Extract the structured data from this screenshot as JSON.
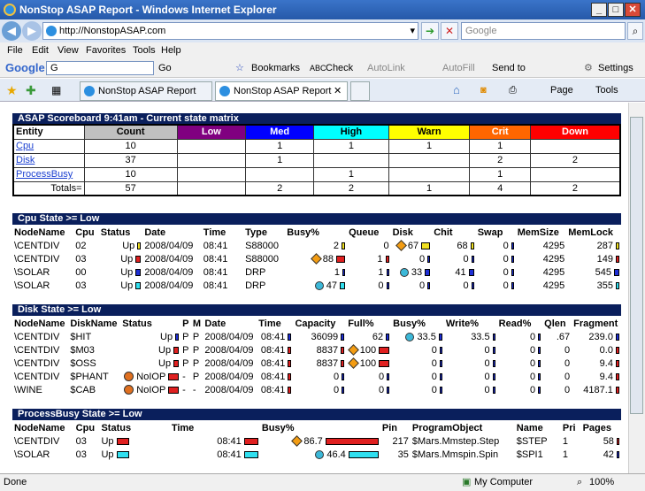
{
  "window": {
    "title": "NonStop ASAP Report - Windows Internet Explorer"
  },
  "address": {
    "url": "http://NonstopASAP.com",
    "search_placeholder": "Google"
  },
  "menu": [
    "File",
    "Edit",
    "View",
    "Favorites",
    "Tools",
    "Help"
  ],
  "google_bar": {
    "logo": "Google",
    "go": "Go",
    "bookmarks": "Bookmarks",
    "check": "Check",
    "autolink": "AutoLink",
    "autofill": "AutoFill",
    "sendto": "Send to",
    "settings": "Settings"
  },
  "tabs": [
    "NonStop ASAP Report",
    "NonStop ASAP Report"
  ],
  "cmdbar": {
    "page": "Page",
    "tools": "Tools"
  },
  "status": {
    "left": "Done",
    "zone": "My Computer",
    "zoom": "100%"
  },
  "scoreboard": {
    "title": "ASAP Scoreboard 9:41am - Current state matrix",
    "headers": [
      "Entity",
      "Count",
      "Low",
      "Med",
      "High",
      "Warn",
      "Crit",
      "Down"
    ],
    "header_colors": [
      "#ffffff",
      "#c0c0c0",
      "#800080",
      "#0000ff",
      "#00ffff",
      "#ffff00",
      "#ff6600",
      "#ff0000"
    ],
    "rows": [
      [
        "Cpu",
        "10",
        "",
        "1",
        "1",
        "1",
        "1",
        ""
      ],
      [
        "Disk",
        "37",
        "",
        "1",
        "",
        "",
        "2",
        "2"
      ],
      [
        "ProcessBusy",
        "10",
        "",
        "",
        "1",
        "",
        "1",
        ""
      ],
      [
        "Totals=",
        "57",
        "",
        "2",
        "2",
        "1",
        "4",
        "2"
      ]
    ]
  },
  "cpu": {
    "title": "Cpu State >= Low",
    "headers": [
      "NodeName",
      "Cpu",
      "Status",
      "Date",
      "Time",
      "Type",
      "Busy%",
      "Queue",
      "Disk",
      "Chit",
      "Swap",
      "MemSize",
      "MemLock"
    ],
    "rows": [
      [
        "\\CENTDIV",
        "02",
        "Up",
        "2008/04/09",
        "08:41",
        "S88000",
        "2",
        "0",
        "67",
        "68",
        "0",
        "4295",
        "287"
      ],
      [
        "\\CENTDIV",
        "03",
        "Up",
        "2008/04/09",
        "08:41",
        "S88000",
        "88",
        "1",
        "0",
        "0",
        "0",
        "4295",
        "149"
      ],
      [
        "\\SOLAR",
        "00",
        "Up",
        "2008/04/09",
        "08:41",
        "DRP",
        "1",
        "1",
        "33",
        "41",
        "0",
        "4295",
        "545"
      ],
      [
        "\\SOLAR",
        "03",
        "Up",
        "2008/04/09",
        "08:41",
        "DRP",
        "47",
        "0",
        "0",
        "0",
        "0",
        "4295",
        "355"
      ]
    ]
  },
  "disk": {
    "title": "Disk State >= Low",
    "headers": [
      "NodeName",
      "DiskName",
      "Status",
      "P",
      "M",
      "Date",
      "Time",
      "Capacity",
      "Full%",
      "Busy%",
      "Write%",
      "Read%",
      "Qlen",
      "Fragment"
    ],
    "rows": [
      [
        "\\CENTDIV",
        "$HIT",
        "Up",
        "P",
        "P",
        "2008/04/09",
        "08:41",
        "36099",
        "62",
        "33.5",
        "33.5",
        "0",
        ".67",
        "239.0"
      ],
      [
        "\\CENTDIV",
        "$M03",
        "Up",
        "P",
        "P",
        "2008/04/09",
        "08:41",
        "8837",
        "100",
        "0",
        "0",
        "0",
        "0",
        "0.0"
      ],
      [
        "\\CENTDIV",
        "$OSS",
        "Up",
        "P",
        "P",
        "2008/04/09",
        "08:41",
        "8837",
        "100",
        "0",
        "0",
        "0",
        "0",
        "9.4"
      ],
      [
        "\\CENTDIV",
        "$PHANT",
        "NoIOP",
        "-",
        "P",
        "2008/04/09",
        "08:41",
        "0",
        "0",
        "0",
        "0",
        "0",
        "0",
        "9.4"
      ],
      [
        "\\WINE",
        "$CAB",
        "NoIOP",
        "-",
        "-",
        "2008/04/09",
        "08:41",
        "0",
        "0",
        "0",
        "0",
        "0",
        "0",
        "4187.1"
      ]
    ]
  },
  "proc": {
    "title": "ProcessBusy State >= Low",
    "headers": [
      "NodeName",
      "Cpu",
      "Status",
      "Time",
      "Busy%",
      "Pin",
      "ProgramObject",
      "Name",
      "Pri",
      "Pages"
    ],
    "rows": [
      [
        "\\CENTDIV",
        "03",
        "Up",
        "08:41",
        "86.7",
        "217",
        "$Mars.Mmstep.Step",
        "$STEP",
        "1",
        "58"
      ],
      [
        "\\SOLAR",
        "03",
        "Up",
        "08:41",
        "46.4",
        "35",
        "$Mars.Mmspin.Spin",
        "$SPI1",
        "1",
        "42"
      ]
    ]
  }
}
